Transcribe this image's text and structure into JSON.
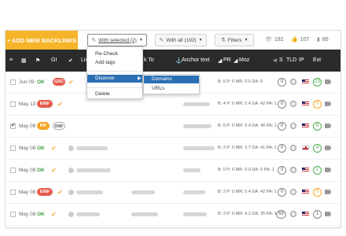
{
  "toolbar": {
    "add_new": "+ ADD NEW BACKLINKS",
    "with_selected": "With selected (2)",
    "with_all": "With all (192)",
    "filters": "Filters",
    "stat_views": "192",
    "stat_likes": "107",
    "stat_links": "85"
  },
  "header": {
    "gi": "GI",
    "link": "Lin",
    "link_to": "k To",
    "anchor": "Anchor text",
    "pr": "PR",
    "moz": "Moz",
    "s": "S",
    "tld": "TLD",
    "ip": "IP",
    "ext": "Ext"
  },
  "menu": {
    "recheck": "Re-Check",
    "add_tags": "Add tags",
    "disavow": "Disavow",
    "arrow": "▶",
    "delete": "Delete"
  },
  "submenu": {
    "domains": "Domains",
    "urls": "URLs"
  },
  "rows": [
    {
      "date": "Jun 09",
      "status": "OK",
      "tag": "GSC",
      "checked": false,
      "metric_top": "B: 6 P: 0 MR: 0.5 DA: 0",
      "ext": "23",
      "ext_color": "green",
      "s": "0",
      "flag": "us"
    },
    {
      "date": "May 13",
      "status": "",
      "tag": "EINF",
      "checked": false,
      "metric_top": "B: 4 P: 0 MR: 5.4 DA: 42 PA: 1",
      "ext": "5",
      "ext_color": "orange",
      "s": "0",
      "flag": "us"
    },
    {
      "date": "May 09",
      "status": "",
      "tag": "INF",
      "tag2": "DNF",
      "checked": true,
      "metric_top": "B: 5 P: 0 MR: 5.4 DA: 46 PA: 1",
      "ext": "6",
      "ext_color": "green",
      "s": "0",
      "flag": "us"
    },
    {
      "date": "May 08",
      "status": "OK",
      "tag": "",
      "checked": false,
      "metric_top": "B: 2 P: 0 MR: 3.7 DA: 41 PA: 1",
      "ext": "4",
      "ext_color": "green",
      "s": "0",
      "flag": "gb"
    },
    {
      "date": "May 08",
      "status": "OK",
      "tag": "",
      "checked": false,
      "metric_top": "B: 0 P: 0 MR: 0.0 DA: 0 PA: 1",
      "ext": "1",
      "ext_color": "green",
      "s": "0",
      "flag": "us"
    },
    {
      "date": "May 08",
      "status": "",
      "tag": "EINF",
      "checked": false,
      "metric_top": "B: 2 P: 0 MR: 5.4 DA: 42 PA: 1",
      "ext": "5",
      "ext_color": "orange",
      "s": "0",
      "flag": "us"
    },
    {
      "date": "May 08",
      "status": "OK",
      "tag": "",
      "checked": false,
      "metric_top": "B: 2 P: 0 MR: 4.2 DA: 35 PA: 1",
      "ext": "1",
      "ext_color": "gray",
      "s": "69",
      "flag": "us"
    },
    {
      "date": "May 08",
      "status": "OK",
      "tag": "",
      "checked": false,
      "metric_top": "B: 1 P: 0 MR: 4.0 DA: 32 PA: 1",
      "ext": "4",
      "ext_color": "green",
      "s": "0",
      "flag": "us"
    }
  ]
}
